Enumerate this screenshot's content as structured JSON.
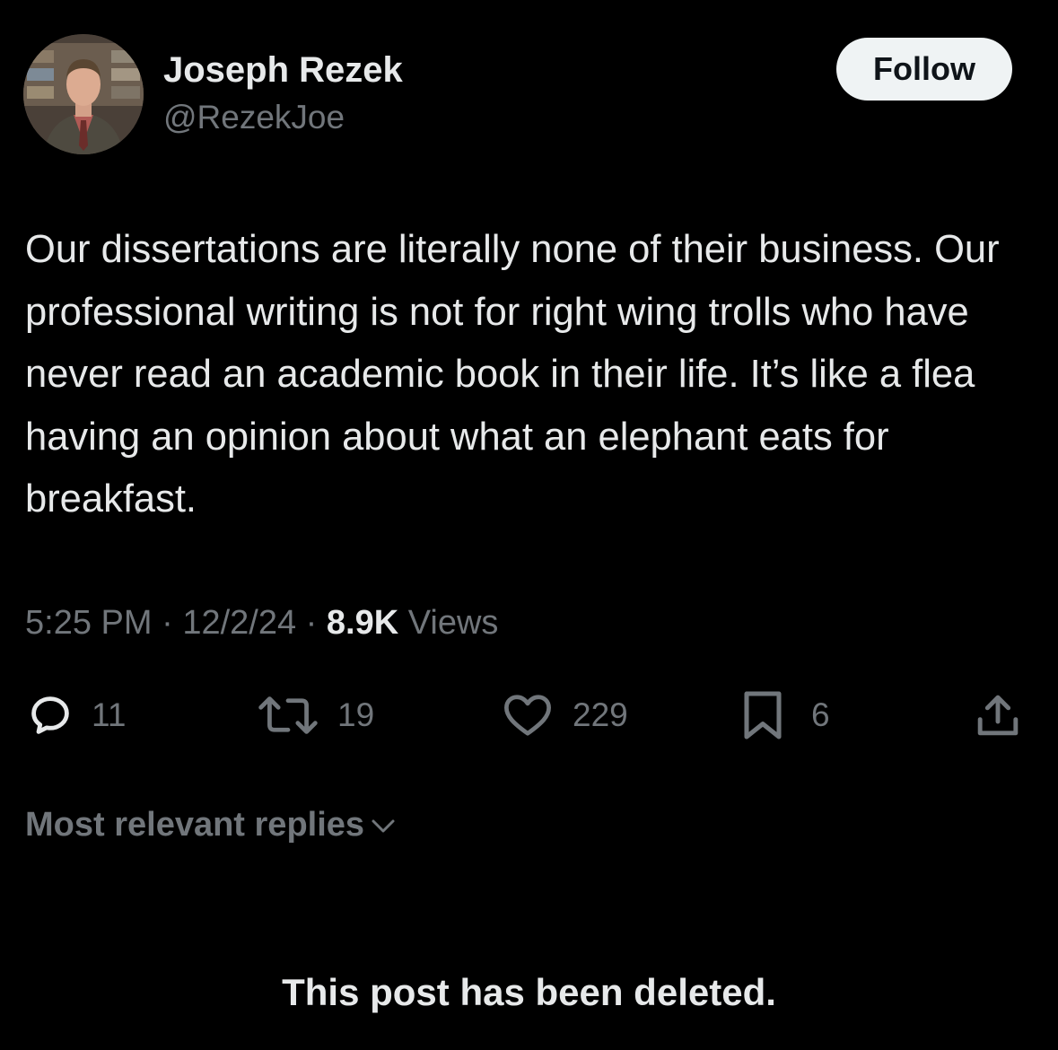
{
  "author": {
    "display_name": "Joseph Rezek",
    "handle": "@RezekJoe"
  },
  "follow_button": {
    "label": "Follow"
  },
  "tweet": {
    "text": "Our dissertations are literally none of their business. Our professional writing is not for right wing trolls who have never read an academic book in their life. It’s like a flea having an opinion about what an elephant eats for breakfast.",
    "time": "5:25 PM",
    "date": "12/2/24",
    "separator": "·",
    "views_count": "8.9K",
    "views_label": "Views"
  },
  "actions": {
    "reply": {
      "icon": "reply-icon",
      "count": "11"
    },
    "repost": {
      "icon": "repost-icon",
      "count": "19"
    },
    "like": {
      "icon": "heart-icon",
      "count": "229"
    },
    "bookmark": {
      "icon": "bookmark-icon",
      "count": "6"
    },
    "share": {
      "icon": "share-icon"
    }
  },
  "replies": {
    "sort_label": "Most relevant replies",
    "deleted_notice": "This post has been deleted."
  },
  "colors": {
    "background": "#000000",
    "primary_text": "#e7e9ea",
    "secondary_text": "#71767b",
    "follow_button_bg": "#eff3f4",
    "follow_button_text": "#0f1419"
  }
}
